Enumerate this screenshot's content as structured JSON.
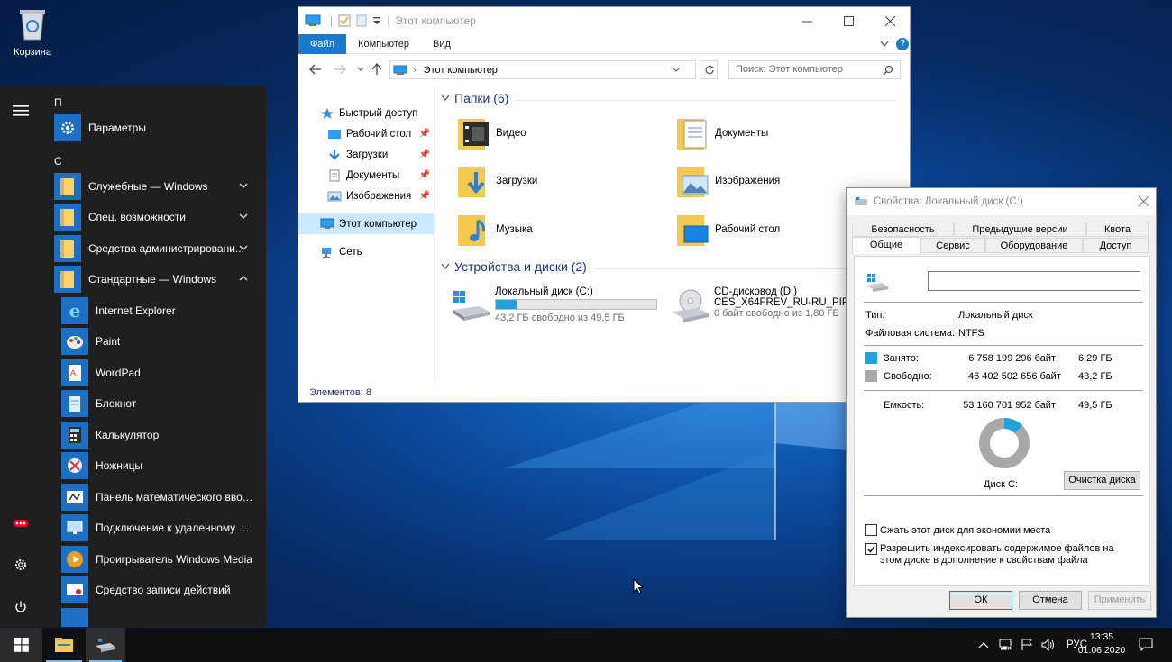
{
  "colors": {
    "accent": "#1979ca",
    "used": "#26a0da",
    "free": "#a8a8a8"
  },
  "desktop": {
    "recycle_label": "Корзина"
  },
  "start_menu": {
    "groups": [
      "П",
      "С"
    ],
    "items": [
      {
        "label": "Параметры",
        "icon": "gear-icon"
      },
      {
        "label": "Служебные — Windows",
        "icon": "folder-icon"
      },
      {
        "label": "Спец. возможности",
        "icon": "folder-icon"
      },
      {
        "label": "Средства администрировани...",
        "icon": "folder-icon"
      },
      {
        "label": "Стандартные — Windows",
        "icon": "folder-icon"
      },
      {
        "label": "Internet Explorer",
        "icon": "ie-icon"
      },
      {
        "label": "Paint",
        "icon": "paint-icon"
      },
      {
        "label": "WordPad",
        "icon": "wordpad-icon"
      },
      {
        "label": "Блокнот",
        "icon": "notepad-icon"
      },
      {
        "label": "Калькулятор",
        "icon": "calculator-icon"
      },
      {
        "label": "Ножницы",
        "icon": "scissors-icon"
      },
      {
        "label": "Панель математического ввода",
        "icon": "math-input-icon"
      },
      {
        "label": "Подключение к удаленному ра...",
        "icon": "remote-desktop-icon"
      },
      {
        "label": "Проигрыватель Windows Media",
        "icon": "media-player-icon"
      },
      {
        "label": "Средство записи действий",
        "icon": "steps-recorder-icon"
      }
    ]
  },
  "explorer": {
    "title": "Этот компьютер",
    "tabs": [
      "Файл",
      "Компьютер",
      "Вид"
    ],
    "address": "Этот компьютер",
    "search_placeholder": "Поиск: Этот компьютер",
    "nav": [
      {
        "label": "Быстрый доступ"
      },
      {
        "label": "Рабочий стол"
      },
      {
        "label": "Загрузки"
      },
      {
        "label": "Документы"
      },
      {
        "label": "Изображения"
      },
      {
        "label": "Этот компьютер"
      },
      {
        "label": "Сеть"
      }
    ],
    "folders_header": "Папки (6)",
    "folders": [
      "Видео",
      "Документы",
      "Загрузки",
      "Изображения",
      "Музыка",
      "Рабочий стол"
    ],
    "devices_header": "Устройства и диски (2)",
    "drives": [
      {
        "name": "Локальный диск (C:)",
        "free": "43,2 ГБ свободно из 49,5 ГБ",
        "used_fraction": 0.127
      },
      {
        "name": "CD-дисковод (D:)",
        "label": "CES_X64FREV_RU-RU_PIP",
        "free": "0 байт свободно из 1,80 ГБ"
      }
    ],
    "status": "Элементов: 8"
  },
  "properties": {
    "title": "Свойства: Локальный диск (C:)",
    "tabs_row1": [
      "Безопасность",
      "Предыдущие версии",
      "Квота"
    ],
    "tabs_row2": [
      "Общие",
      "Сервис",
      "Оборудование",
      "Доступ"
    ],
    "type_label": "Тип:",
    "type_value": "Локальный диск",
    "fs_label": "Файловая система:",
    "fs_value": "NTFS",
    "used_label": "Занято:",
    "used_bytes": "6 758 199 296 байт",
    "used_gb": "6,29 ГБ",
    "free_label": "Свободно:",
    "free_bytes": "46 402 502 656 байт",
    "free_gb": "43,2 ГБ",
    "cap_label": "Емкость:",
    "cap_bytes": "53 160 701 952 байт",
    "cap_gb": "49,5 ГБ",
    "disk_label": "Диск C:",
    "cleanup": "Очистка диска",
    "compress": "Сжать этот диск для экономии места",
    "index": "Разрешить индексировать содержимое файлов на этом диске в дополнение к свойствам файла",
    "ok": "ОК",
    "cancel": "Отмена",
    "apply": "Применить",
    "used_fraction": 0.127
  },
  "taskbar": {
    "lang": "РУС",
    "time": "13:35",
    "date": "01.06.2020"
  }
}
